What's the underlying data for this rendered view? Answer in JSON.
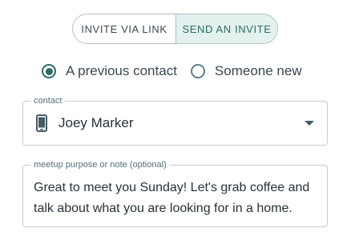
{
  "toggle": {
    "left_label": "INVITE VIA LINK",
    "right_label": "SEND AN INVITE",
    "selected": "right"
  },
  "recipient": {
    "options": [
      "A previous contact",
      "Someone new"
    ],
    "selected": "A previous contact"
  },
  "contact_field": {
    "legend": "contact",
    "value": "Joey Marker",
    "icon": "phone-icon"
  },
  "note_field": {
    "legend": "meetup purpose or note (optional)",
    "value": "Great to meet you Sunday! Let's grab coffee and talk about what you are looking for in a home."
  },
  "colors": {
    "accent": "#2a6b62",
    "accent_bg": "#e3f2ef",
    "border": "#c5ccd0"
  }
}
